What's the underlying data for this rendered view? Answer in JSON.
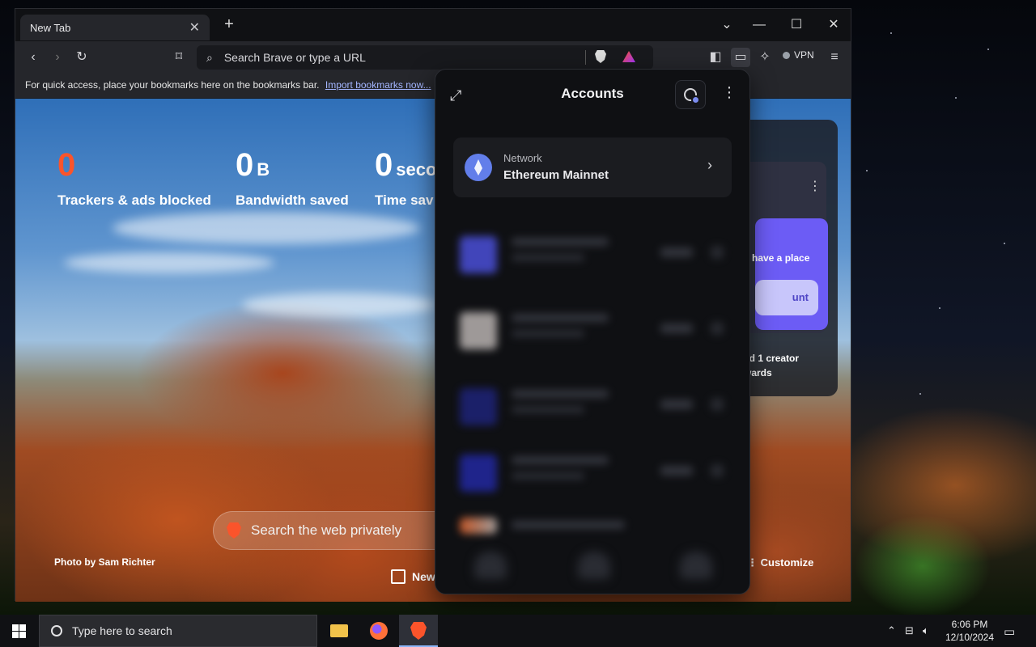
{
  "browser": {
    "tab_title": "New Tab",
    "address_placeholder": "Search Brave or type a URL",
    "vpn_label": "VPN",
    "bookmarks_message": "For quick access, place your bookmarks here on the bookmarks bar.",
    "import_bookmarks_link": "Import bookmarks now..."
  },
  "ntp": {
    "stats": [
      {
        "value": "0",
        "unit": "",
        "label": "Trackers & ads blocked",
        "color": "#fb542b"
      },
      {
        "value": "0",
        "unit": "B",
        "label": "Bandwidth saved",
        "color": "#f1f1f1"
      },
      {
        "value": "0",
        "unit": "seco",
        "label": "Time sav",
        "color": "#f1f1f1"
      }
    ],
    "search_placeholder": "Search the web privately",
    "photo_credit": "Photo by Sam Richter",
    "news_label": "New",
    "customize_label": "Customize"
  },
  "rewards_card": {
    "promo_text": "have a place",
    "button_text": "unt",
    "footer_line1": "ed 1 creator",
    "footer_line2": "wards"
  },
  "wallet": {
    "title": "Accounts",
    "network_label": "Network",
    "network_name": "Ethereum Mainnet",
    "accent_color": "#627eea"
  },
  "taskbar": {
    "search_placeholder": "Type here to search",
    "time": "6:06 PM",
    "date": "12/10/2024"
  }
}
